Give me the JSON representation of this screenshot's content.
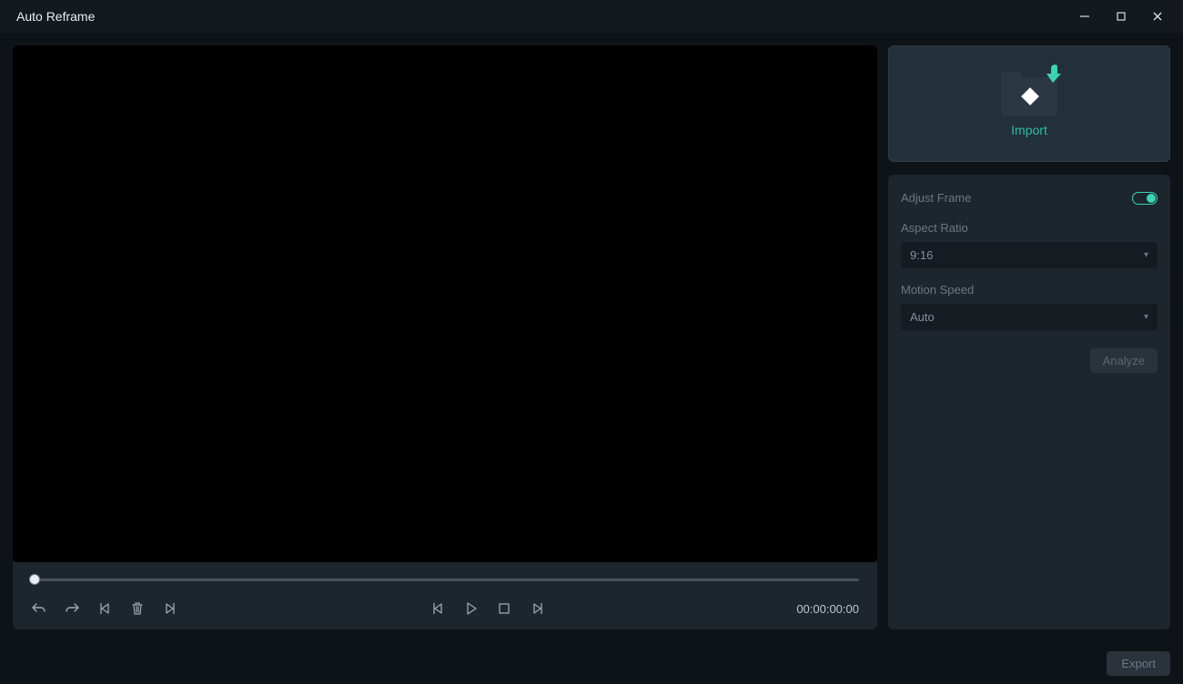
{
  "titlebar": {
    "title": "Auto Reframe"
  },
  "import": {
    "label": "Import"
  },
  "settings": {
    "adjust_frame_label": "Adjust Frame",
    "adjust_frame_on": true,
    "aspect_ratio_label": "Aspect Ratio",
    "aspect_ratio_value": "9:16",
    "motion_speed_label": "Motion Speed",
    "motion_speed_value": "Auto",
    "analyze_label": "Analyze"
  },
  "playback": {
    "timecode": "00:00:00:00"
  },
  "footer": {
    "export_label": "Export"
  }
}
